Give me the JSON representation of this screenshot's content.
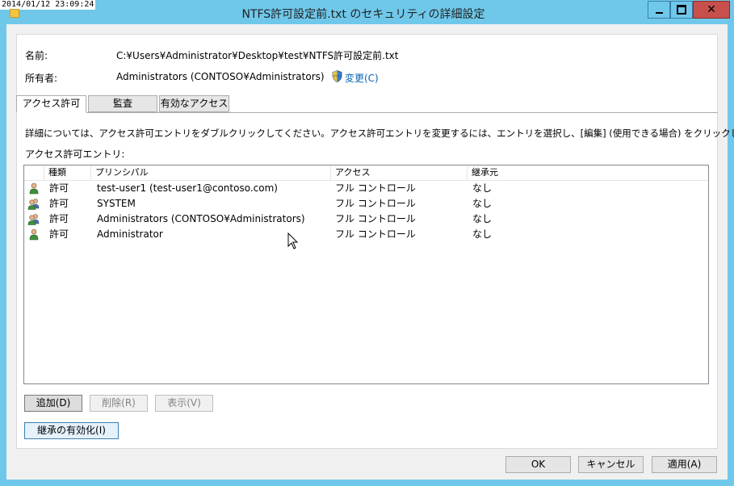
{
  "screen": {
    "timestamp": "2014/01/12 23:09:24"
  },
  "window": {
    "title": "NTFS許可設定前.txt のセキュリティの詳細設定",
    "controls": {
      "minimize": "—",
      "maximize": "□",
      "close": "✕"
    }
  },
  "info": {
    "name_label": "名前:",
    "name_value": "C:¥Users¥Administrator¥Desktop¥test¥NTFS許可設定前.txt",
    "owner_label": "所有者:",
    "owner_value": "Administrators (CONTOSO¥Administrators)",
    "change_link": "変更(C)"
  },
  "tabs": [
    "アクセス許可",
    "監査",
    "有効なアクセス"
  ],
  "instructions": "詳細については、アクセス許可エントリをダブルクリックしてください。アクセス許可エントリを変更するには、エントリを選択し、[編集] (使用できる場合) をクリックします。",
  "entries_label": "アクセス許可エントリ:",
  "table": {
    "columns": [
      "種類",
      "プリンシパル",
      "アクセス",
      "継承元"
    ],
    "rows": [
      {
        "icon": "user-icon",
        "type": "許可",
        "principal": "test-user1 (test-user1@contoso.com)",
        "access": "フル コントロール",
        "inherited": "なし"
      },
      {
        "icon": "group-icon",
        "type": "許可",
        "principal": "SYSTEM",
        "access": "フル コントロール",
        "inherited": "なし"
      },
      {
        "icon": "group-icon",
        "type": "許可",
        "principal": "Administrators (CONTOSO¥Administrators)",
        "access": "フル コントロール",
        "inherited": "なし"
      },
      {
        "icon": "user-icon",
        "type": "許可",
        "principal": "Administrator",
        "access": "フル コントロール",
        "inherited": "なし"
      }
    ]
  },
  "buttons": {
    "add": "追加(D)",
    "remove": "削除(R)",
    "view": "表示(V)",
    "enable_inheritance": "継承の有効化(I)",
    "ok": "OK",
    "cancel": "キャンセル",
    "apply": "適用(A)"
  },
  "colors": {
    "titlebar": "#6fc8ea",
    "close": "#c7504c",
    "link": "#0a63b0"
  }
}
